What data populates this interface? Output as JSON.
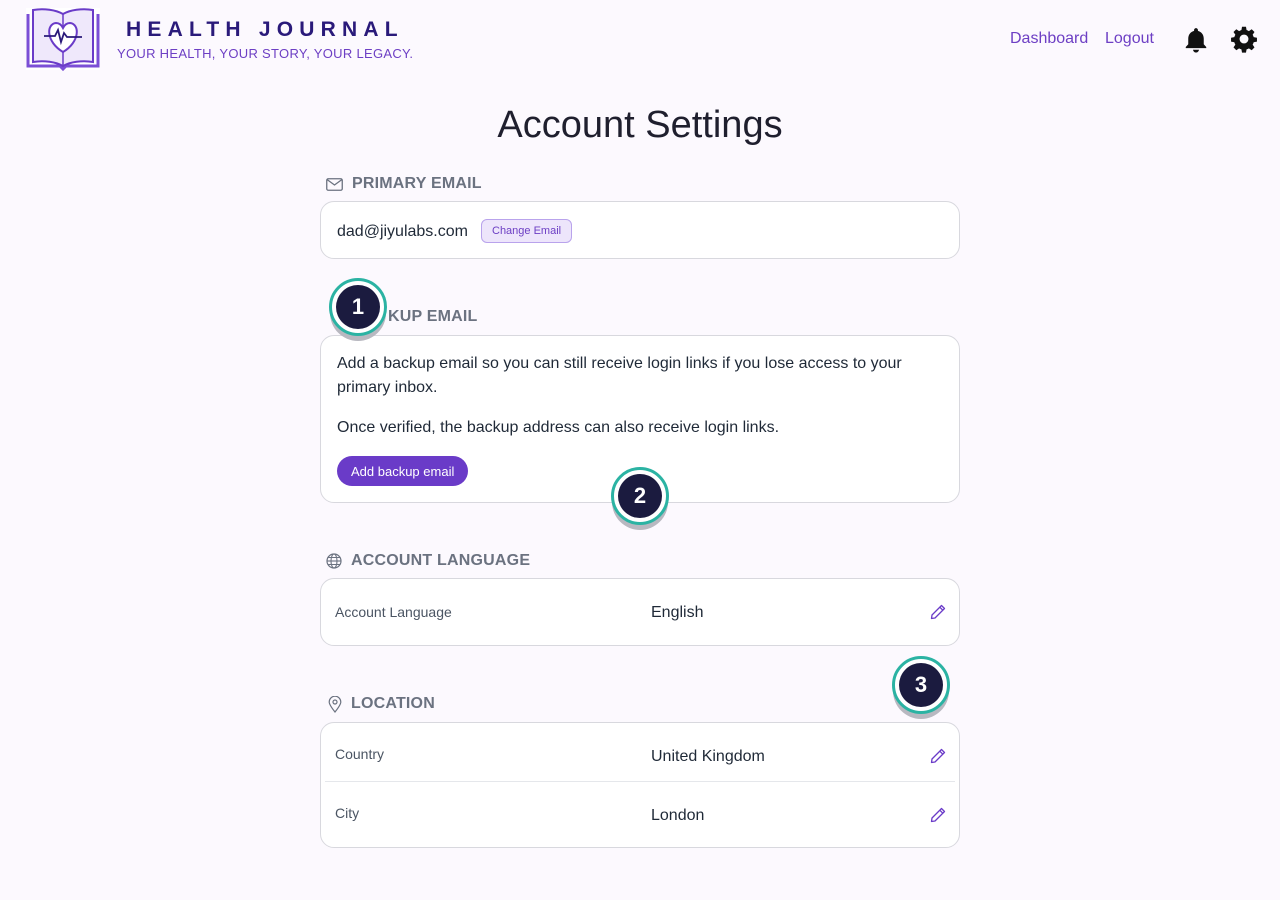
{
  "brand": {
    "title": "HEALTH JOURNAL",
    "tagline": "YOUR HEALTH, YOUR STORY, YOUR LEGACY.",
    "logo_icon": "book-heart-icon"
  },
  "nav": {
    "dashboard": "Dashboard",
    "logout": "Logout",
    "notifications_icon": "bell-icon",
    "settings_icon": "gear-icon"
  },
  "page": {
    "title": "Account Settings"
  },
  "primary_email": {
    "label": "PRIMARY EMAIL",
    "icon": "envelope-icon",
    "value": "dad@jiyulabs.com",
    "change_button": "Change Email"
  },
  "backup_email": {
    "label": "BACKUP EMAIL",
    "label_visible": "KUP EMAIL",
    "description": "Add a backup email so you can still receive login links if you lose access to your primary inbox.",
    "note": "Once verified, the backup address can also receive login links.",
    "add_button": "Add backup email"
  },
  "account_language": {
    "label": "ACCOUNT LANGUAGE",
    "icon": "globe-icon",
    "row_label": "Account Language",
    "value": "English"
  },
  "location": {
    "label": "LOCATION",
    "icon": "map-pin-icon",
    "country_label": "Country",
    "country_value": "United Kingdom",
    "city_label": "City",
    "city_value": "London"
  },
  "markers": [
    "1",
    "2",
    "3"
  ],
  "colors": {
    "accent": "#6a3bc8",
    "brand_dark": "#2a1a7a",
    "marker_ring": "#2bb3a3",
    "marker_fill": "#1b1b3f",
    "background": "#fcf9fe"
  }
}
